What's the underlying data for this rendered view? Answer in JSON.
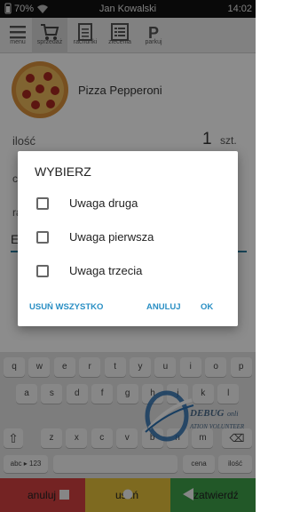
{
  "status_bar": {
    "battery": "70%",
    "user": "Jan Kowalski",
    "time": "14:02"
  },
  "toolbar": {
    "items": [
      {
        "label": "menu",
        "icon": "menu-icon"
      },
      {
        "label": "sprzedaż",
        "icon": "cart-icon",
        "active": true
      },
      {
        "label": "rachunki",
        "icon": "receipt-icon"
      },
      {
        "label": "zlecenia",
        "icon": "list-icon"
      },
      {
        "label": "parkuj",
        "icon": "parking-icon"
      }
    ]
  },
  "product": {
    "name": "Pizza Pepperoni",
    "image": "pizza-image"
  },
  "quantity": {
    "label": "ilość",
    "value": "1",
    "unit": "szt."
  },
  "background_rows": {
    "c": "c",
    "r": "ra",
    "e": "E"
  },
  "dialog": {
    "title": "WYBIERZ",
    "options": [
      {
        "label": "Uwaga druga",
        "checked": false
      },
      {
        "label": "Uwaga pierwsza",
        "checked": false
      },
      {
        "label": "Uwaga trzecia",
        "checked": false
      }
    ],
    "clear_all_label": "USUŃ WSZYSTKO",
    "cancel_label": "ANULUJ",
    "ok_label": "OK"
  },
  "keyboard": {
    "row1": [
      "q",
      "w",
      "e",
      "r",
      "t",
      "y",
      "u",
      "i",
      "o",
      "p"
    ],
    "row2": [
      "a",
      "s",
      "d",
      "f",
      "g",
      "h",
      "j",
      "k",
      "l"
    ],
    "row3": [
      "z",
      "x",
      "c",
      "v",
      "b",
      "n",
      "m"
    ],
    "mode_key": "abc ▸ 123",
    "cena_key": "cena",
    "ilosc_key": "ilość"
  },
  "watermark": {
    "text1": "DEBUG",
    "text2": "onli",
    "text3": "ATION VOLUNTEER"
  },
  "bottom_bar": {
    "cancel": "anuluj",
    "delete": "usuń",
    "confirm": "zatwierdź"
  },
  "colors": {
    "cancel": "#d44040",
    "delete": "#e5c13b",
    "confirm": "#3fa04a",
    "accent": "#2a8fc4"
  }
}
